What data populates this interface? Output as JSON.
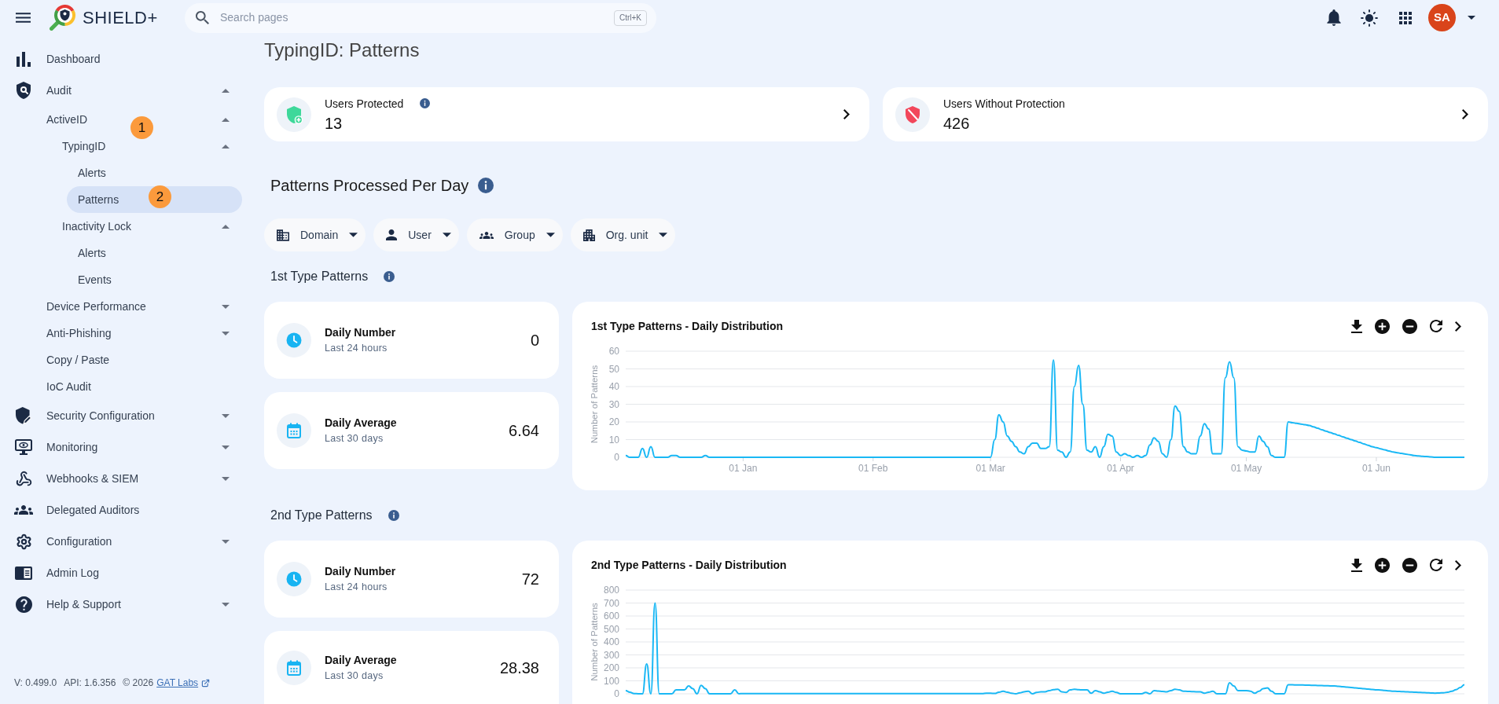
{
  "header": {
    "logo_text": "SHIELD+",
    "search": {
      "placeholder": "Search pages",
      "shortcut": "Ctrl+K"
    },
    "avatar": {
      "initials": "SA"
    }
  },
  "sidebar": {
    "items": [
      {
        "label": "Dashboard",
        "selected": false
      },
      {
        "label": "Audit",
        "selected": false,
        "expanded": true,
        "children": [
          {
            "label": "ActiveID",
            "selected": false,
            "expanded": true,
            "children": [
              {
                "label": "TypingID",
                "selected": false,
                "expanded": true,
                "children": [
                  {
                    "label": "Alerts",
                    "selected": false
                  },
                  {
                    "label": "Patterns",
                    "selected": true
                  }
                ]
              },
              {
                "label": "Inactivity Lock",
                "selected": false,
                "expanded": true,
                "children": [
                  {
                    "label": "Alerts",
                    "selected": false
                  },
                  {
                    "label": "Events",
                    "selected": false
                  }
                ]
              }
            ]
          },
          {
            "label": "Device Performance",
            "selected": false,
            "expanded": false
          },
          {
            "label": "Anti-Phishing",
            "selected": false,
            "expanded": false
          },
          {
            "label": "Copy / Paste",
            "selected": false
          },
          {
            "label": "IoC Audit",
            "selected": false
          }
        ]
      },
      {
        "label": "Security Configuration",
        "selected": false,
        "expanded": false
      },
      {
        "label": "Monitoring",
        "selected": false,
        "expanded": false
      },
      {
        "label": "Webhooks & SIEM",
        "selected": false,
        "expanded": false
      },
      {
        "label": "Delegated Auditors",
        "selected": false
      },
      {
        "label": "Configuration",
        "selected": false,
        "expanded": false
      },
      {
        "label": "Admin Log",
        "selected": false
      },
      {
        "label": "Help & Support",
        "selected": false,
        "expanded": false
      }
    ],
    "footer": {
      "version": "V: 0.499.0",
      "api": "API: 1.6.356",
      "copyright": "© 2026",
      "link": "GAT Labs"
    }
  },
  "annotations": [
    {
      "label": "1"
    },
    {
      "label": "2"
    }
  ],
  "page": {
    "title": "TypingID: Patterns",
    "summary_cards": [
      {
        "kind": "protected",
        "label": "Users Protected",
        "info": true,
        "value": "13"
      },
      {
        "kind": "unprotected",
        "label": "Users Without Protection",
        "info": false,
        "value": "426"
      }
    ],
    "section_title": "Patterns Processed Per Day",
    "filters": [
      "Domain",
      "User",
      "Group",
      "Org. unit"
    ],
    "pattern_sections": [
      {
        "title": "1st Type Patterns",
        "stats": [
          {
            "label": "Daily Number",
            "sublabel": "Last 24 hours",
            "value": "0"
          },
          {
            "label": "Daily Average",
            "sublabel": "Last 30 days",
            "value": "6.64"
          }
        ],
        "chart_data": {
          "type": "line",
          "title": "1st Type Patterns - Daily Distribution",
          "ylabel": "Number of Patterns",
          "grid": true,
          "categories": [
            null,
            null,
            null,
            null,
            null,
            null,
            null,
            null,
            null,
            null,
            null,
            null,
            null,
            null,
            null,
            null,
            null,
            null,
            null,
            null,
            null,
            null,
            null,
            null,
            null,
            null,
            null,
            null,
            "01 Jan",
            null,
            null,
            null,
            null,
            null,
            null,
            null,
            null,
            null,
            null,
            null,
            null,
            null,
            null,
            null,
            null,
            null,
            null,
            null,
            null,
            null,
            null,
            null,
            null,
            null,
            null,
            null,
            null,
            null,
            null,
            "01 Feb",
            null,
            null,
            null,
            null,
            null,
            null,
            null,
            null,
            null,
            null,
            null,
            null,
            null,
            null,
            null,
            null,
            null,
            null,
            null,
            null,
            null,
            null,
            null,
            null,
            null,
            null,
            null,
            "01 Mar",
            null,
            null,
            null,
            null,
            null,
            null,
            null,
            null,
            null,
            null,
            null,
            null,
            null,
            null,
            null,
            null,
            null,
            null,
            null,
            null,
            null,
            null,
            null,
            null,
            null,
            null,
            null,
            null,
            null,
            null,
            "01 Apr",
            null,
            null,
            null,
            null,
            null,
            null,
            null,
            null,
            null,
            null,
            null,
            null,
            null,
            null,
            null,
            null,
            null,
            null,
            null,
            null,
            null,
            null,
            null,
            null,
            null,
            null,
            null,
            null,
            null,
            "01 May",
            null,
            null,
            null,
            null,
            null,
            null,
            null,
            null,
            null,
            null,
            null,
            null,
            null,
            null,
            null,
            null,
            null,
            null,
            null,
            null,
            null,
            null,
            null,
            null,
            null,
            null,
            null,
            null,
            null,
            null,
            "01 Jun",
            null,
            null,
            null,
            null,
            null,
            null,
            null,
            null,
            null,
            null,
            null,
            null,
            null,
            null,
            null,
            null,
            null,
            null,
            null,
            null,
            null
          ],
          "series": [
            {
              "color": "#1ab8f5",
              "values": [
                1,
                0,
                0,
                0,
                5,
                0,
                6,
                0,
                0,
                0,
                0,
                1,
                1,
                0,
                0,
                0,
                0,
                0,
                0,
                1,
                0,
                0,
                0,
                0,
                0,
                0,
                0,
                0,
                0,
                0,
                0,
                0,
                0,
                0,
                0,
                0,
                0,
                0,
                0,
                0,
                0,
                0,
                0,
                0,
                0,
                0,
                0,
                0,
                0,
                0,
                0,
                0,
                0,
                0,
                0,
                0,
                0,
                0,
                0,
                0,
                0,
                0,
                0,
                0,
                0,
                0,
                0,
                0,
                0,
                0,
                0,
                0,
                0,
                0,
                0,
                0,
                0,
                0,
                0,
                0,
                0,
                0,
                0,
                0,
                0,
                0,
                0,
                0,
                10,
                24,
                20,
                12,
                9,
                6,
                3,
                2,
                6,
                8,
                8,
                5,
                5,
                6,
                55,
                4,
                3,
                0,
                3,
                40,
                52,
                30,
                4,
                3,
                6,
                0,
                6,
                13,
                12,
                3,
                1,
                2,
                1,
                0,
                1,
                0,
                1,
                7,
                11,
                9,
                2,
                0,
                10,
                29,
                26,
                6,
                3,
                2,
                2,
                12,
                19,
                16,
                2,
                2,
                2,
                45,
                54,
                45,
                6,
                4,
                3.5,
                3,
                3,
                12,
                9,
                6,
                1,
                0,
                0,
                0,
                20,
                19.6,
                19.2,
                18.8,
                18.4,
                18,
                17.2,
                16.4,
                15.6,
                14.8,
                14,
                13.2,
                12.4,
                11.6,
                10.8,
                10,
                9.2,
                8.4,
                7.6,
                6.8,
                6,
                5.4,
                4.8,
                4.2,
                3.6,
                3,
                2.6,
                2.2,
                1.8,
                1.4,
                1,
                0.8,
                0.6,
                0.4,
                0.2,
                0,
                0,
                0,
                0,
                0,
                0,
                0,
                0
              ]
            }
          ],
          "ylim": [
            0,
            60
          ],
          "yticks": [
            0,
            10,
            20,
            30,
            40,
            50,
            60
          ]
        }
      },
      {
        "title": "2nd Type Patterns",
        "stats": [
          {
            "label": "Daily Number",
            "sublabel": "Last 24 hours",
            "value": "72"
          },
          {
            "label": "Daily Average",
            "sublabel": "Last 30 days",
            "value": "28.38"
          }
        ],
        "chart_data": {
          "type": "line",
          "title": "2nd Type Patterns - Daily Distribution",
          "ylabel": "Number of Patterns",
          "grid": true,
          "categories": [
            null,
            null,
            null,
            null,
            null,
            null,
            null,
            null,
            null,
            null,
            null,
            null,
            null,
            null,
            null,
            null,
            null,
            null,
            null,
            null,
            null,
            null,
            null,
            null,
            null,
            null,
            null,
            null,
            null,
            null,
            null,
            null,
            null,
            null,
            null,
            null,
            null,
            null,
            null,
            null,
            null,
            null,
            null,
            null,
            null,
            null,
            null,
            null,
            null,
            null,
            null,
            null,
            null,
            null,
            null,
            null,
            null,
            null,
            null,
            null,
            null,
            null,
            null,
            null,
            null,
            null,
            null,
            null,
            null,
            null,
            null,
            null,
            null,
            null,
            null,
            null,
            null,
            null,
            null,
            null,
            null,
            null,
            null,
            null,
            null,
            null,
            null,
            null,
            null,
            null,
            null,
            null,
            null,
            null,
            null,
            null,
            null,
            null,
            null,
            null,
            null,
            null,
            null,
            null,
            null,
            null,
            null,
            null,
            null,
            null,
            null,
            null,
            null,
            null,
            null,
            null,
            null,
            null,
            null,
            null,
            null,
            null,
            null,
            null,
            null,
            null,
            null,
            null,
            null,
            null,
            null,
            null,
            null,
            null,
            null,
            null,
            null,
            null,
            null,
            null,
            null,
            null,
            null,
            null,
            null,
            null,
            null,
            null,
            null,
            null,
            null,
            null,
            null,
            null,
            null,
            null,
            null,
            null,
            null,
            null,
            null,
            null,
            null,
            null,
            null,
            null,
            null,
            null,
            null,
            null,
            null,
            null,
            null,
            null,
            null,
            null,
            null,
            null,
            null,
            null,
            null,
            null,
            null,
            null,
            null,
            null,
            null,
            null,
            null,
            null,
            null,
            null,
            null,
            null,
            null,
            null,
            null,
            null,
            null,
            null,
            null
          ],
          "series": [
            {
              "color": "#1ab8f5",
              "values": [
                25,
                12,
                2,
                0,
                0,
                230,
                0,
                700,
                0,
                0,
                0,
                0,
                30,
                30,
                30,
                60,
                40,
                0,
                65,
                40,
                0,
                0,
                0,
                0,
                0,
                0,
                30,
                0,
                2,
                2,
                2,
                2,
                2,
                2,
                2,
                2,
                2,
                2,
                2,
                2,
                2,
                2,
                2,
                2,
                2,
                2,
                2,
                2,
                2,
                2,
                2,
                2,
                2,
                2,
                2,
                2,
                2,
                2,
                2,
                2,
                2,
                2,
                2,
                2,
                2,
                2,
                2,
                2,
                2,
                2,
                2,
                2,
                2,
                2,
                2,
                2,
                2,
                2,
                2,
                2,
                2,
                2,
                2,
                2,
                2,
                2,
                5,
                4,
                3,
                12,
                20,
                12,
                5,
                0,
                8,
                16,
                20,
                0,
                10,
                15,
                15,
                25,
                32,
                35,
                15,
                10,
                30,
                35,
                32,
                30,
                30,
                5,
                25,
                15,
                5,
                12,
                20,
                10,
                0,
                0,
                0,
                0,
                0,
                0,
                10,
                0,
                25,
                22,
                18,
                15,
                25,
                35,
                30,
                20,
                18,
                17,
                16,
                15,
                5,
                12,
                20,
                0,
                0,
                0,
                85,
                60,
                25,
                25,
                25,
                20,
                5,
                20,
                40,
                45,
                20,
                0,
                0,
                0,
                70,
                69,
                68,
                68,
                67,
                66,
                65,
                64,
                63,
                62,
                61,
                60,
                57,
                54,
                51,
                49,
                46,
                43,
                40,
                37,
                34,
                31,
                29,
                26,
                23,
                20,
                18,
                17,
                15,
                14,
                12,
                11,
                9,
                8,
                6,
                5,
                6,
                8,
                12,
                20,
                32,
                48,
                70
              ]
            }
          ],
          "ylim": [
            0,
            800
          ],
          "yticks": [
            0,
            100,
            200,
            300,
            400,
            500,
            600,
            700,
            800
          ]
        }
      }
    ]
  }
}
